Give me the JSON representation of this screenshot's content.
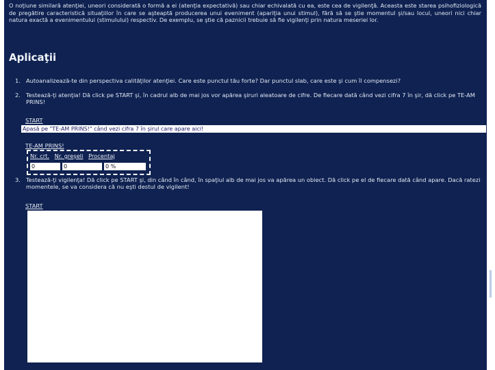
{
  "intro_text": "O noţiune similară atenţiei, uneori considerată o formă a ei (atenţia expectativă) sau chiar echivalată cu ea, este cea de vigilenţă. Aceasta este starea psihofiziologică de pregătire caracteristică situaţiilor în care se aşteaptă producerea unui eveniment (apariţia unui stimul), fără să se ştie momentul şi/sau locul, uneori nici chiar natura exactă a evenimentului (stimulului) respectiv. De exemplu, se ştie că paznicii trebuie să fie vigilenţi prin natura meseriei lor.",
  "section_title": "Aplicaţii",
  "items": [
    {
      "num": "1.",
      "text": "Autoanalizează-te din perspectiva calităţilor atenţiei. Care este punctul tău forte? Dar punctul slab, care este şi cum îl compensezi?"
    },
    {
      "num": "2.",
      "text": "Testează-ţi atenţia! Dă click pe START şi, în cadrul alb de mai jos vor apărea şiruri aleatoare de cifre. De fiecare dată când vezi cifra 7 în şir, dă click pe TE-AM PRINS!"
    },
    {
      "num": "3.",
      "text": "Testează-ţi vigilenţa! Dă click pe START şi, din când în când, în spaţiul alb de mai jos va apărea un obiect. Dă click pe el de fiecare dată când apare. Dacă ratezi momentele, se va considera că nu eşti destul de vigilent!"
    }
  ],
  "test1": {
    "start_label": "START",
    "sequence_text": "Apasă pe \"TE-AM PRINS!\" când vezi cifra 7 în şirul care apare aici!",
    "caught_label": "TE-AM PRINS!",
    "stats_headers": [
      "Nr. crt.",
      "Nr. greşeli",
      "Procentaj"
    ],
    "stats_values": [
      "0",
      "0",
      "0 %"
    ]
  },
  "test2": {
    "start_label": "START"
  },
  "colors": {
    "background": "#0f2251",
    "text": "#e4e9f5",
    "box": "#ffffff"
  }
}
